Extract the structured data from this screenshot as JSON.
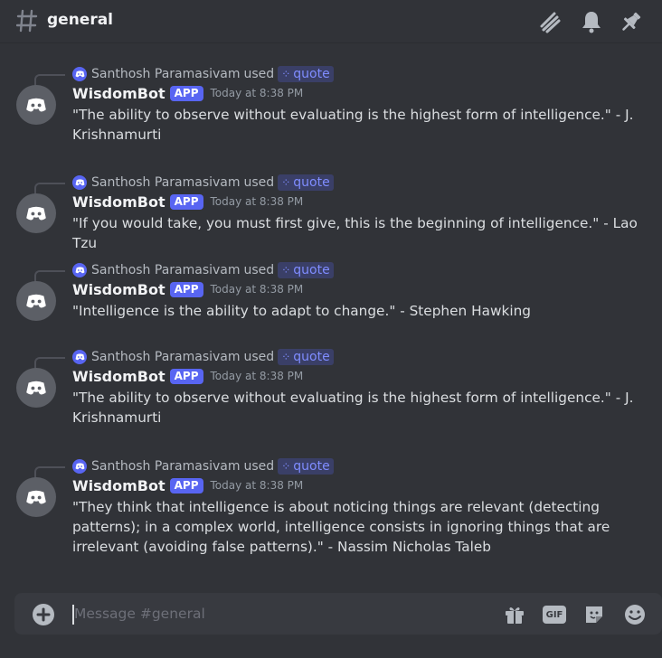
{
  "header": {
    "channel_name": "general"
  },
  "messages": [
    {
      "reply_user": "Santhosh Paramasivam",
      "reply_used": "used",
      "command": "quote",
      "bot_name": "WisdomBot",
      "badge": "APP",
      "timestamp": "Today at 8:38 PM",
      "text": "\"The ability to observe without evaluating is the highest form of intelligence.\" - J. Krishnamurti"
    },
    {
      "reply_user": "Santhosh Paramasivam",
      "reply_used": "used",
      "command": "quote",
      "bot_name": "WisdomBot",
      "badge": "APP",
      "timestamp": "Today at 8:38 PM",
      "text": "\"If you would take, you must first give, this is the beginning of intelligence.\" - Lao Tzu"
    },
    {
      "reply_user": "Santhosh Paramasivam",
      "reply_used": "used",
      "command": "quote",
      "bot_name": "WisdomBot",
      "badge": "APP",
      "timestamp": "Today at 8:38 PM",
      "text": "\"Intelligence is the ability to adapt to change.\" - Stephen Hawking"
    },
    {
      "reply_user": "Santhosh Paramasivam",
      "reply_used": "used",
      "command": "quote",
      "bot_name": "WisdomBot",
      "badge": "APP",
      "timestamp": "Today at 8:38 PM",
      "text": "\"The ability to observe without evaluating is the highest form of intelligence.\" - J. Krishnamurti"
    },
    {
      "reply_user": "Santhosh Paramasivam",
      "reply_used": "used",
      "command": "quote",
      "bot_name": "WisdomBot",
      "badge": "APP",
      "timestamp": "Today at 8:38 PM",
      "text": "\"They think that intelligence is about noticing things are relevant (detecting patterns); in a complex world, intelligence consists in ignoring things that are irrelevant (avoiding false patterns).\" - Nassim Nicholas Taleb"
    }
  ],
  "composer": {
    "placeholder": "Message #general",
    "gif_label": "GIF"
  },
  "icons": {
    "header": [
      "hash-icon",
      "threads-icon",
      "notification-bell-icon",
      "pin-icon"
    ],
    "composer": [
      "add-attachment-icon",
      "gift-icon",
      "gif-icon",
      "sticker-icon",
      "emoji-icon"
    ]
  },
  "colors": {
    "background": "#313338",
    "composer": "#383a40",
    "brand": "#5865f2",
    "command_text": "#7f8cff",
    "timestamp": "#949ba4"
  }
}
